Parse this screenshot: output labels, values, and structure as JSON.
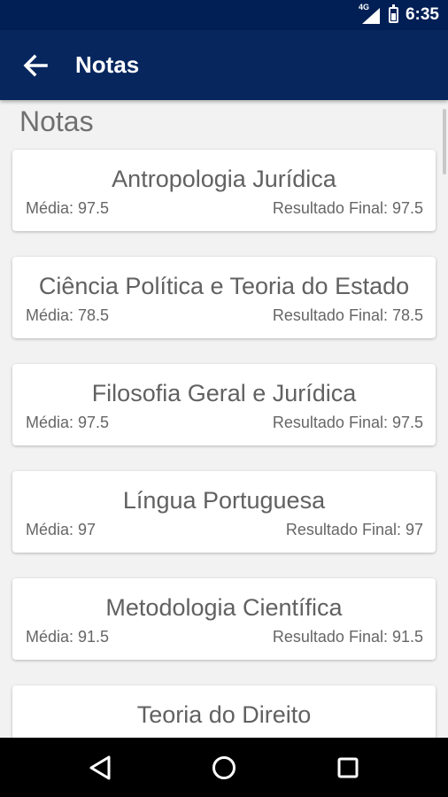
{
  "status_bar": {
    "network": "4G",
    "time": "6:35"
  },
  "app_bar": {
    "title": "Notas",
    "back_icon": "arrow-back-icon"
  },
  "page": {
    "section_title": "Notas"
  },
  "grades": [
    {
      "subject": "Antropologia Jurídica",
      "media": "Média: 97.5",
      "final": "Resultado Final: 97.5"
    },
    {
      "subject": "Ciência Política e Teoria do Estado",
      "media": "Média: 78.5",
      "final": "Resultado Final: 78.5"
    },
    {
      "subject": "Filosofia Geral e Jurídica",
      "media": "Média: 97.5",
      "final": "Resultado Final: 97.5"
    },
    {
      "subject": "Língua Portuguesa",
      "media": "Média: 97",
      "final": "Resultado Final: 97"
    },
    {
      "subject": "Metodologia Científica",
      "media": "Média: 91.5",
      "final": "Resultado Final: 91.5"
    },
    {
      "subject": "Teoria do Direito",
      "media": "",
      "final": ""
    }
  ],
  "nav_bar": {
    "icons": [
      "back-triangle-icon",
      "home-circle-icon",
      "recents-square-icon"
    ]
  },
  "colors": {
    "status_bar": "#021f55",
    "app_bar": "#07265e",
    "background": "#f2f2f2"
  }
}
